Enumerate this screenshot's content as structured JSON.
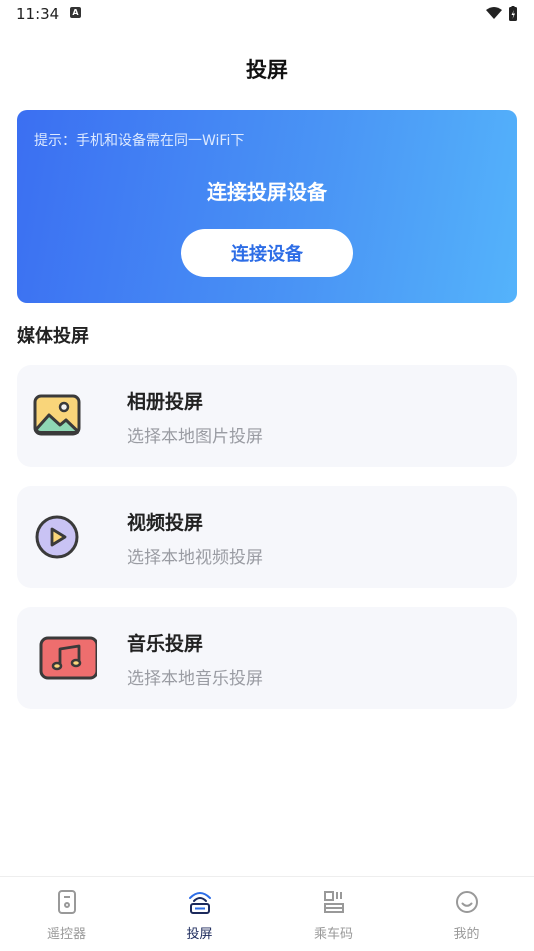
{
  "status": {
    "time": "11:34",
    "notification_letter": "A"
  },
  "header": {
    "title": "投屏"
  },
  "connect": {
    "hint": "提示：手机和设备需在同一WiFi下",
    "title": "连接投屏设备",
    "button_label": "连接设备"
  },
  "section": {
    "title": "媒体投屏"
  },
  "media": [
    {
      "title": "相册投屏",
      "subtitle": "选择本地图片投屏",
      "icon": "photo-icon"
    },
    {
      "title": "视频投屏",
      "subtitle": "选择本地视频投屏",
      "icon": "video-icon"
    },
    {
      "title": "音乐投屏",
      "subtitle": "选择本地音乐投屏",
      "icon": "music-icon"
    }
  ],
  "tabs": [
    {
      "label": "遥控器",
      "icon": "remote-icon",
      "active": false
    },
    {
      "label": "投屏",
      "icon": "cast-icon",
      "active": true
    },
    {
      "label": "乘车码",
      "icon": "qr-code-icon",
      "active": false
    },
    {
      "label": "我的",
      "icon": "smile-icon",
      "active": false
    }
  ],
  "colors": {
    "accent": "#2d6de6",
    "card_gradient_start": "#3b6ff2",
    "card_gradient_end": "#54b3fb",
    "active_tab": "#1c2a5c",
    "inactive_tab": "#999999"
  }
}
